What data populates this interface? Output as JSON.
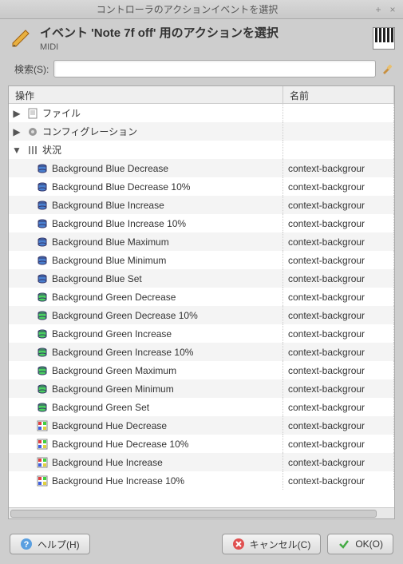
{
  "window": {
    "title": "コントローラのアクションイベントを選択"
  },
  "header": {
    "title": "イベント 'Note 7f off' 用のアクションを選択",
    "subtitle": "MIDI"
  },
  "search": {
    "label": "検索(S):",
    "value": ""
  },
  "columns": {
    "op": "操作",
    "name": "名前"
  },
  "folders": {
    "file": "ファイル",
    "config": "コンフィグレーション",
    "situation": "状況"
  },
  "rows": [
    {
      "op": "Background Blue Decrease",
      "name": "context-backgrour",
      "icon": "blue"
    },
    {
      "op": "Background Blue Decrease 10%",
      "name": "context-backgrour",
      "icon": "blue"
    },
    {
      "op": "Background Blue Increase",
      "name": "context-backgrour",
      "icon": "blue"
    },
    {
      "op": "Background Blue Increase 10%",
      "name": "context-backgrour",
      "icon": "blue"
    },
    {
      "op": "Background Blue Maximum",
      "name": "context-backgrour",
      "icon": "blue"
    },
    {
      "op": "Background Blue Minimum",
      "name": "context-backgrour",
      "icon": "blue"
    },
    {
      "op": "Background Blue Set",
      "name": "context-backgrour",
      "icon": "blue"
    },
    {
      "op": "Background Green Decrease",
      "name": "context-backgrour",
      "icon": "green"
    },
    {
      "op": "Background Green Decrease 10%",
      "name": "context-backgrour",
      "icon": "green"
    },
    {
      "op": "Background Green Increase",
      "name": "context-backgrour",
      "icon": "green"
    },
    {
      "op": "Background Green Increase 10%",
      "name": "context-backgrour",
      "icon": "green"
    },
    {
      "op": "Background Green Maximum",
      "name": "context-backgrour",
      "icon": "green"
    },
    {
      "op": "Background Green Minimum",
      "name": "context-backgrour",
      "icon": "green"
    },
    {
      "op": "Background Green Set",
      "name": "context-backgrour",
      "icon": "green"
    },
    {
      "op": "Background Hue Decrease",
      "name": "context-backgrour",
      "icon": "rgb"
    },
    {
      "op": "Background Hue Decrease 10%",
      "name": "context-backgrour",
      "icon": "rgb"
    },
    {
      "op": "Background Hue Increase",
      "name": "context-backgrour",
      "icon": "rgb"
    },
    {
      "op": "Background Hue Increase 10%",
      "name": "context-backgrour",
      "icon": "rgb"
    }
  ],
  "buttons": {
    "help": "ヘルプ(H)",
    "cancel": "キャンセル(C)",
    "ok": "OK(O)"
  }
}
